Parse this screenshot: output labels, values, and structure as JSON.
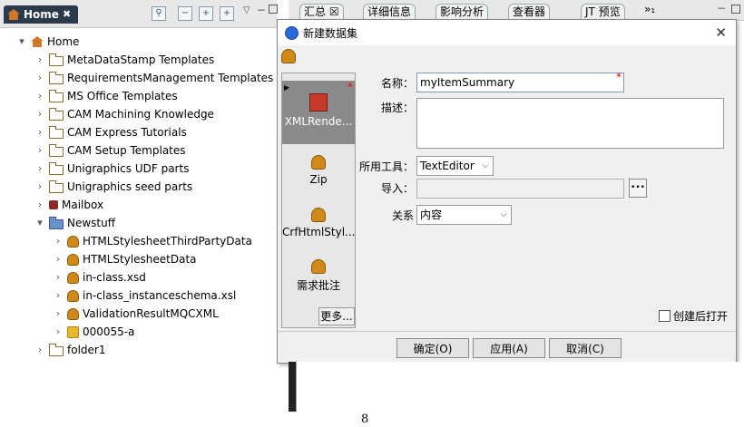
{
  "left_panel": {
    "tab_label": "Home",
    "tree": [
      {
        "label": "Home",
        "arrow": "▾",
        "icon": "home-icon",
        "depth": 0
      },
      {
        "label": "MetaDataStamp Templates",
        "arrow": "›",
        "icon": "folder-icon",
        "depth": 1
      },
      {
        "label": "RequirementsManagement Templates",
        "arrow": "›",
        "icon": "folder-icon",
        "depth": 1
      },
      {
        "label": "MS Office Templates",
        "arrow": "›",
        "icon": "folder-icon",
        "depth": 1
      },
      {
        "label": "CAM Machining Knowledge",
        "arrow": "›",
        "icon": "folder-icon",
        "depth": 1
      },
      {
        "label": "CAM Express Tutorials",
        "arrow": "›",
        "icon": "folder-icon",
        "depth": 1
      },
      {
        "label": "CAM Setup Templates",
        "arrow": "›",
        "icon": "folder-icon",
        "depth": 1
      },
      {
        "label": "Unigraphics UDF parts",
        "arrow": "›",
        "icon": "folder-icon",
        "depth": 1
      },
      {
        "label": "Unigraphics seed parts",
        "arrow": "›",
        "icon": "folder-icon",
        "depth": 1
      },
      {
        "label": "Mailbox",
        "arrow": "›",
        "icon": "mailbox-icon",
        "depth": 1
      },
      {
        "label": "Newstuff",
        "arrow": "▾",
        "icon": "open-folder-icon",
        "depth": 1
      },
      {
        "label": "HTMLStylesheetThirdPartyData",
        "arrow": "›",
        "icon": "dataset-icon",
        "depth": 2
      },
      {
        "label": "HTMLStylesheetData",
        "arrow": "›",
        "icon": "dataset-icon",
        "depth": 2
      },
      {
        "label": "in-class.xsd",
        "arrow": "›",
        "icon": "dataset-icon",
        "depth": 2
      },
      {
        "label": "in-class_instanceschema.xsl",
        "arrow": "›",
        "icon": "dataset-icon",
        "depth": 2
      },
      {
        "label": "ValidationResultMQCXML",
        "arrow": "›",
        "icon": "dataset-icon",
        "depth": 2
      },
      {
        "label": "000055-a",
        "arrow": "›",
        "icon": "item-icon",
        "depth": 2
      },
      {
        "label": "folder1",
        "arrow": "›",
        "icon": "folder-icon",
        "depth": 1
      }
    ]
  },
  "right_tabs": [
    {
      "label": "汇总 ☒"
    },
    {
      "label": "详细信息"
    },
    {
      "label": "影响分析"
    },
    {
      "label": "查看器"
    },
    {
      "label": "JT 预览"
    },
    {
      "label": "»₁"
    }
  ],
  "dialog": {
    "title": "新建数据集",
    "close_glyph": "✕",
    "palette": [
      {
        "label": "XMLRende...",
        "selected": true
      },
      {
        "label": "Zip",
        "selected": false
      },
      {
        "label": "CrfHtmlStyl...",
        "selected": false
      },
      {
        "label": "需求批注",
        "selected": false
      }
    ],
    "more_label": "更多...",
    "name_label": "名称：",
    "name_value": "myItemSummary",
    "required_mark": "*",
    "desc_label": "描述：",
    "desc_value": "",
    "tool_label": "所用工具：",
    "tool_value": "TextEditor",
    "import_label": "导入：",
    "import_value": "",
    "browse_label": "•••",
    "relation_label": "关系",
    "relation_value": "内容",
    "open_after_label": "创建后打开",
    "open_after_checked": false,
    "ok_label": "确定(O)",
    "apply_label": "应用(A)",
    "cancel_label": "取消(C)"
  },
  "page_number": "8"
}
